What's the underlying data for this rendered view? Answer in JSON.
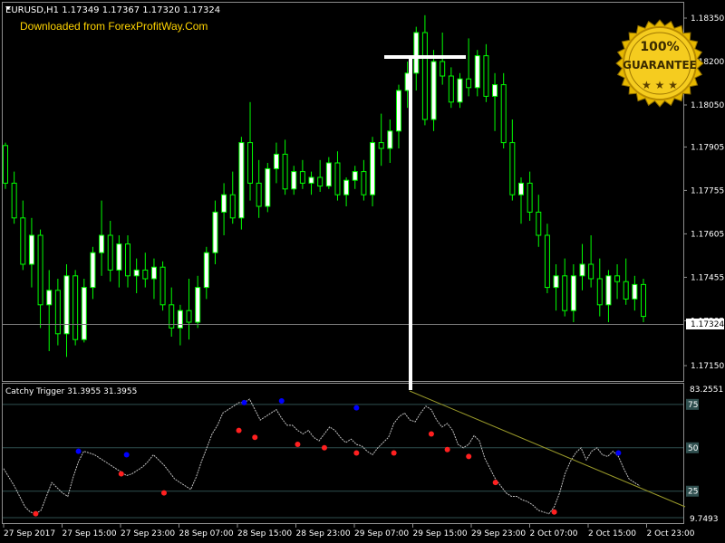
{
  "header": {
    "symbol_line": "EURUSD,H1  1.17349 1.17367 1.17320 1.17324",
    "watermark": "Downloaded from ForexProfitWay.Com"
  },
  "badge": {
    "line1": "100%",
    "line2": "GUARANTEE"
  },
  "price_axis": {
    "ticks": [
      "1.18350",
      "1.18200",
      "1.18050",
      "1.17905",
      "1.17755",
      "1.17605",
      "1.17455",
      "1.17305",
      "1.17150"
    ],
    "current_price": "1.17324"
  },
  "indicator": {
    "title": "Catchy Trigger 31.3955 31.3955",
    "max_label": "83.2551",
    "min_label": "9.7493",
    "levels": [
      "75",
      "50",
      "25"
    ]
  },
  "time_axis": {
    "ticks": [
      "27 Sep 2017",
      "27 Sep 15:00",
      "27 Sep 23:00",
      "28 Sep 07:00",
      "28 Sep 15:00",
      "28 Sep 23:00",
      "29 Sep 07:00",
      "29 Sep 15:00",
      "29 Sep 23:00",
      "2 Oct 07:00",
      "2 Oct 15:00",
      "2 Oct 23:00"
    ]
  },
  "colors": {
    "background": "#000000",
    "bull_candle": "#ffffff",
    "bear_candle": "#000000",
    "wick": "#00ff00",
    "grid": "#8c8c8c",
    "indicator_line": "#c0c0c0",
    "trendline": "#9a9a2a",
    "dot_top": "#0000ff",
    "dot_bottom": "#ff2020",
    "watermark": "#ffd400"
  },
  "chart_data": [
    {
      "type": "candlestick",
      "title": "EURUSD,H1",
      "ylim": [
        1.171,
        1.184
      ],
      "yticks": [
        1.1835,
        1.182,
        1.1805,
        1.17905,
        1.17755,
        1.17605,
        1.17455,
        1.17305,
        1.1715
      ],
      "candles": [
        [
          1.1791,
          1.1792,
          1.1776,
          1.1778
        ],
        [
          1.1778,
          1.1782,
          1.1764,
          1.1766
        ],
        [
          1.1766,
          1.1772,
          1.1748,
          1.175
        ],
        [
          1.175,
          1.1766,
          1.1742,
          1.176
        ],
        [
          1.176,
          1.1762,
          1.1728,
          1.1736
        ],
        [
          1.1736,
          1.1748,
          1.172,
          1.1741
        ],
        [
          1.1741,
          1.1745,
          1.1722,
          1.1726
        ],
        [
          1.1726,
          1.175,
          1.1718,
          1.1746
        ],
        [
          1.1746,
          1.1748,
          1.1722,
          1.1724
        ],
        [
          1.1724,
          1.1745,
          1.1723,
          1.1742
        ],
        [
          1.1742,
          1.1756,
          1.1738,
          1.1754
        ],
        [
          1.1754,
          1.1772,
          1.1746,
          1.176
        ],
        [
          1.176,
          1.1765,
          1.1744,
          1.1748
        ],
        [
          1.1748,
          1.176,
          1.1742,
          1.1757
        ],
        [
          1.1757,
          1.176,
          1.1742,
          1.1746
        ],
        [
          1.1746,
          1.1752,
          1.174,
          1.1748
        ],
        [
          1.1748,
          1.1754,
          1.1742,
          1.1745
        ],
        [
          1.1745,
          1.1752,
          1.1738,
          1.1749
        ],
        [
          1.1749,
          1.1751,
          1.1734,
          1.1736
        ],
        [
          1.1736,
          1.1742,
          1.1725,
          1.1728
        ],
        [
          1.1728,
          1.1736,
          1.1722,
          1.1734
        ],
        [
          1.1734,
          1.1745,
          1.1724,
          1.173
        ],
        [
          1.173,
          1.1746,
          1.1728,
          1.1742
        ],
        [
          1.1742,
          1.1756,
          1.1738,
          1.1754
        ],
        [
          1.1754,
          1.1772,
          1.175,
          1.1768
        ],
        [
          1.1768,
          1.1778,
          1.176,
          1.1774
        ],
        [
          1.1774,
          1.1782,
          1.1764,
          1.1766
        ],
        [
          1.1766,
          1.1794,
          1.1762,
          1.1792
        ],
        [
          1.1792,
          1.1806,
          1.1772,
          1.1778
        ],
        [
          1.1778,
          1.1786,
          1.1766,
          1.177
        ],
        [
          1.177,
          1.1785,
          1.1768,
          1.1783
        ],
        [
          1.1783,
          1.1792,
          1.1778,
          1.1788
        ],
        [
          1.1788,
          1.1793,
          1.1774,
          1.1776
        ],
        [
          1.1776,
          1.1784,
          1.1774,
          1.1782
        ],
        [
          1.1782,
          1.1786,
          1.1776,
          1.1778
        ],
        [
          1.1778,
          1.1782,
          1.1774,
          1.178
        ],
        [
          1.178,
          1.1786,
          1.1775,
          1.1777
        ],
        [
          1.1777,
          1.1787,
          1.1776,
          1.1785
        ],
        [
          1.1785,
          1.1789,
          1.1772,
          1.1774
        ],
        [
          1.1774,
          1.178,
          1.177,
          1.1779
        ],
        [
          1.1779,
          1.1784,
          1.1776,
          1.1782
        ],
        [
          1.1782,
          1.1786,
          1.1772,
          1.1774
        ],
        [
          1.1774,
          1.1794,
          1.177,
          1.1792
        ],
        [
          1.1792,
          1.1802,
          1.1784,
          1.179
        ],
        [
          1.179,
          1.18,
          1.1785,
          1.1796
        ],
        [
          1.1796,
          1.1812,
          1.179,
          1.181
        ],
        [
          1.181,
          1.182,
          1.1804,
          1.1816
        ],
        [
          1.1816,
          1.1832,
          1.181,
          1.183
        ],
        [
          1.183,
          1.1836,
          1.1798,
          1.18
        ],
        [
          1.18,
          1.1824,
          1.1796,
          1.182
        ],
        [
          1.182,
          1.183,
          1.1812,
          1.1815
        ],
        [
          1.1815,
          1.1818,
          1.1804,
          1.1806
        ],
        [
          1.1806,
          1.1816,
          1.1804,
          1.1814
        ],
        [
          1.1814,
          1.1828,
          1.1808,
          1.1811
        ],
        [
          1.1811,
          1.1824,
          1.1808,
          1.1822
        ],
        [
          1.1822,
          1.1826,
          1.1806,
          1.1808
        ],
        [
          1.1808,
          1.1816,
          1.1796,
          1.1812
        ],
        [
          1.1812,
          1.1816,
          1.179,
          1.1792
        ],
        [
          1.1792,
          1.18,
          1.1772,
          1.1774
        ],
        [
          1.1774,
          1.178,
          1.1764,
          1.1778
        ],
        [
          1.1778,
          1.1782,
          1.1765,
          1.1768
        ],
        [
          1.1768,
          1.1774,
          1.1756,
          1.176
        ],
        [
          1.176,
          1.1764,
          1.174,
          1.1742
        ],
        [
          1.1742,
          1.175,
          1.1734,
          1.1746
        ],
        [
          1.1746,
          1.1752,
          1.1732,
          1.1734
        ],
        [
          1.1734,
          1.175,
          1.173,
          1.1746
        ],
        [
          1.1746,
          1.1757,
          1.1741,
          1.175
        ],
        [
          1.175,
          1.176,
          1.1742,
          1.1745
        ],
        [
          1.1745,
          1.1752,
          1.1732,
          1.1736
        ],
        [
          1.1736,
          1.1748,
          1.173,
          1.1746
        ],
        [
          1.1746,
          1.175,
          1.1738,
          1.1744
        ],
        [
          1.1744,
          1.1752,
          1.1736,
          1.1738
        ],
        [
          1.1738,
          1.1746,
          1.1734,
          1.1743
        ],
        [
          1.1743,
          1.1745,
          1.173,
          1.1732
        ]
      ],
      "bull_color": "#ffffff",
      "bear_color": "#000000",
      "wick_color": "#00ff00"
    },
    {
      "type": "line",
      "title": "Catchy Trigger 31.3955 31.3955",
      "ylim": [
        9.7493,
        83.2551
      ],
      "levels": [
        75,
        50,
        25
      ],
      "values": [
        38,
        33,
        28,
        22,
        16,
        13,
        12,
        14,
        22,
        30,
        27,
        24,
        22,
        33,
        42,
        48,
        47,
        46,
        44,
        42,
        40,
        38,
        36,
        34,
        35,
        37,
        39,
        42,
        46,
        43,
        40,
        36,
        32,
        30,
        28,
        26,
        33,
        42,
        50,
        58,
        63,
        70,
        72,
        74,
        76,
        76,
        78,
        72,
        66,
        68,
        70,
        72,
        67,
        63,
        63,
        60,
        58,
        60,
        56,
        54,
        58,
        62,
        60,
        56,
        53,
        55,
        52,
        51,
        48,
        46,
        50,
        53,
        56,
        64,
        68,
        70,
        66,
        65,
        70,
        74,
        72,
        66,
        62,
        64,
        60,
        52,
        50,
        52,
        57,
        54,
        44,
        38,
        32,
        28,
        24,
        22,
        22,
        20,
        19,
        17,
        14,
        13,
        12,
        16,
        24,
        35,
        42,
        47,
        50,
        43,
        48,
        50,
        46,
        45,
        48,
        45,
        38,
        32,
        30,
        28
      ],
      "top_markers": [
        [
          14,
          48
        ],
        [
          23,
          46
        ],
        [
          45,
          76
        ],
        [
          52,
          77
        ],
        [
          66,
          73
        ],
        [
          115,
          47
        ]
      ],
      "bottom_markers": [
        [
          6,
          12
        ],
        [
          22,
          35
        ],
        [
          30,
          24
        ],
        [
          44,
          60
        ],
        [
          47,
          56
        ],
        [
          55,
          52
        ],
        [
          60,
          50
        ],
        [
          66,
          47
        ],
        [
          73,
          47
        ],
        [
          80,
          58
        ],
        [
          83,
          49
        ],
        [
          87,
          45
        ],
        [
          92,
          30
        ],
        [
          103,
          13
        ]
      ],
      "marker_colors": {
        "top": "#0000ff",
        "bottom": "#ff2020"
      }
    }
  ]
}
